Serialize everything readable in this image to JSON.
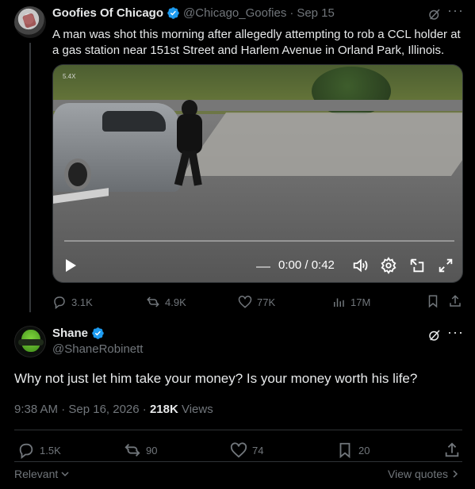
{
  "parent_tweet": {
    "author_name": "Goofies Of Chicago",
    "author_handle": "@Chicago_Goofies",
    "separator": "·",
    "date": "Sep 15",
    "text": "A man was shot this morning after allegedly attempting to rob a CCL holder at a gas station near 151st Street and Harlem Avenue in Orland Park, Illinois.",
    "video": {
      "speed_label": "5.4X",
      "time": "0:00 / 0:42",
      "progress": 0
    },
    "actions": {
      "replies": "3.1K",
      "reposts": "4.9K",
      "likes": "77K",
      "views": "17M"
    }
  },
  "main_tweet": {
    "author_name": "Shane",
    "author_handle": "@ShaneRobinett",
    "text": "Why not just let him take your money? Is your money worth his life?",
    "timestamp": "9:38 AM · Sep 16, 2026 ·",
    "views_count": "218K",
    "views_label": "Views",
    "actions": {
      "replies": "1.5K",
      "reposts": "90",
      "likes": "74",
      "bookmarks": "20"
    }
  },
  "footer": {
    "sort_label": "Relevant",
    "quotes_link": "View quotes"
  },
  "colors": {
    "background": "#000000",
    "text_primary": "#e7e9ea",
    "text_muted": "#71767b",
    "verified": "#1d9bf0",
    "divider": "#2f3336"
  },
  "icons": [
    "verified-badge-icon",
    "grok-icon",
    "more-icon",
    "play-icon",
    "volume-icon",
    "settings-icon",
    "pip-icon",
    "expand-icon",
    "reply-icon",
    "repost-icon",
    "like-icon",
    "views-icon",
    "bookmark-icon",
    "share-icon",
    "chevron-down-icon",
    "chevron-right-icon"
  ]
}
